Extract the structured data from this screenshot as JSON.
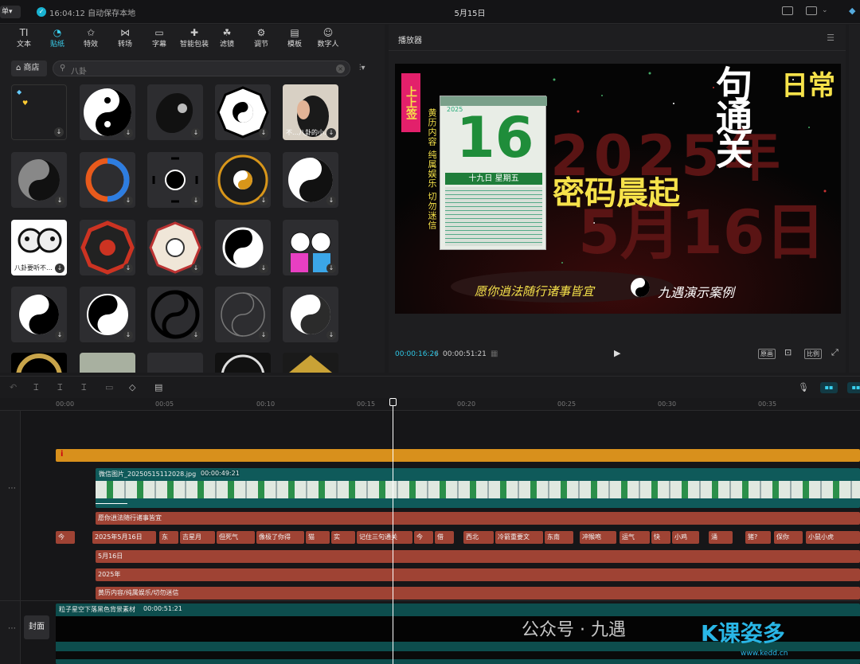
{
  "topbar": {
    "logo": "单▾",
    "save_status": "16:04:12 自动保存本地",
    "title": "5月15日"
  },
  "left_tabs": [
    {
      "glyph": "TI",
      "label": "文本"
    },
    {
      "glyph": "◔",
      "label": "贴纸"
    },
    {
      "glyph": "✩",
      "label": "特效"
    },
    {
      "glyph": "⋈",
      "label": "转场"
    },
    {
      "glyph": "▭",
      "label": "字幕"
    },
    {
      "glyph": "✚",
      "label": "智能包装"
    },
    {
      "glyph": "☘",
      "label": "滤镜"
    },
    {
      "glyph": "⚙",
      "label": "调节"
    },
    {
      "glyph": "▤",
      "label": "模板"
    },
    {
      "glyph": "☺",
      "label": "数字人"
    }
  ],
  "active_tab": "贴纸",
  "store": {
    "label": "商店"
  },
  "search": {
    "value": "八卦"
  },
  "sticker_captions": {
    "fifth": "不…八卦的小…",
    "panda": "八卦要听不…"
  },
  "player": {
    "title": "播放器",
    "current_time": "00:00:16:26",
    "total_time": "00:00:51:21",
    "ctrl_original": "原画",
    "ctrl_ratio": "比例"
  },
  "video": {
    "badge": "上上签",
    "side_text": "黄历内容 纯属娱乐 切勿迷信",
    "cal_day": "16",
    "cal_lunar": "十九日 星期五",
    "cal_year": "2025",
    "headline": "密码晨起",
    "vert_text": "句通关",
    "bg_year": "2025年",
    "bg_date": "5月16日",
    "bottom_left": "愿你逍法随行诸事皆宜",
    "bottom_right": "九遇演示案例",
    "top_right": "日常"
  },
  "timeline": {
    "ticks": [
      "00:00",
      "00:05",
      "00:10",
      "00:15",
      "00:20",
      "00:25",
      "00:30",
      "00:35"
    ],
    "image_clip": {
      "name": "微信图片_20250515112028.jpg",
      "duration": "00:00:49:21"
    },
    "text_tracks": [
      "愿你逍法随行诸事皆宜",
      "5月16日",
      "2025年",
      "黄历内容/纯属娱乐/切勿迷信"
    ],
    "subtitle_chips": [
      "今",
      "2025年5月16日",
      "东",
      "吉星月",
      "但死气",
      "像极了你得",
      "猫",
      "实",
      "记住三句通关",
      "今",
      "借",
      "西北",
      "冷箭重要文",
      "东南",
      "冲猴咆",
      "运气",
      "快",
      "小鸡",
      "涌",
      "猪?",
      "保你",
      "小鼠小虎"
    ],
    "bg_clip": {
      "name": "粒子星空下落黑色背景素材",
      "duration": "00:00:51:21"
    },
    "cover_label": "封面"
  },
  "watermark": {
    "text": "公众号 · 九遇",
    "brand": "K课姿多",
    "url": "www.kedd.cn"
  }
}
